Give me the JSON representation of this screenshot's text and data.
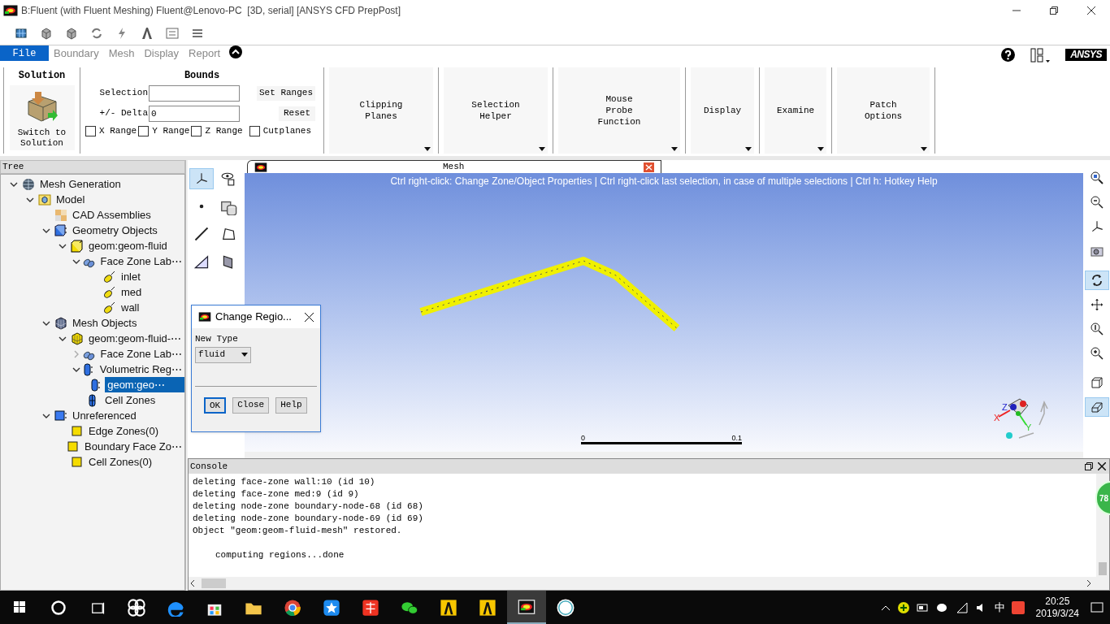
{
  "window": {
    "title": "B:Fluent (with Fluent Meshing) Fluent@Lenovo-PC  [3D, serial] [ANSYS CFD PrepPost]"
  },
  "toolbar": [
    {
      "kind": "mesh"
    },
    {
      "kind": "cube"
    },
    {
      "kind": "cube"
    },
    {
      "kind": "arrows"
    },
    {
      "kind": "bolt"
    },
    {
      "kind": "arch"
    },
    {
      "kind": "swap"
    },
    {
      "kind": "list"
    }
  ],
  "menu_tabs": [
    {
      "label": "File",
      "selected": true
    },
    {
      "label": "Boundary",
      "selected": false
    },
    {
      "label": "Mesh",
      "selected": false
    },
    {
      "label": "Display",
      "selected": false
    },
    {
      "label": "Report",
      "selected": false
    }
  ],
  "brand": "ANSYS",
  "ribbon": {
    "solution": {
      "title": "Solution",
      "button": "Switch to\nSolution"
    },
    "bounds": {
      "title": "Bounds",
      "selection_label": "Selection",
      "delta_label": "+/- Delta",
      "delta_value": "0",
      "set_ranges": "Set Ranges",
      "reset": "Reset",
      "checks": [
        {
          "label": "X Range",
          "checked": false
        },
        {
          "label": "Y Range",
          "checked": false
        },
        {
          "label": "Z Range",
          "checked": false
        },
        {
          "label": "Cutplanes",
          "checked": false
        }
      ]
    },
    "groups": [
      {
        "label": "Clipping\nPlanes"
      },
      {
        "label": "Selection\nHelper"
      },
      {
        "label": "Mouse\nProbe\nFunction"
      },
      {
        "label": "Display"
      },
      {
        "label": "Examine"
      },
      {
        "label": "Patch\nOptions"
      }
    ]
  },
  "tree": {
    "title": "Tree",
    "items": [
      {
        "label": "Mesh Generation",
        "kind": "globe",
        "expanded": true,
        "selected": false,
        "children": [
          {
            "label": "Model",
            "kind": "model",
            "expanded": true,
            "selected": false,
            "children": [
              {
                "label": "CAD Assemblies",
                "kind": "cad",
                "selected": false
              },
              {
                "label": "Geometry Objects",
                "kind": "bluecube",
                "expanded": true,
                "selected": false,
                "children": [
                  {
                    "label": "geom:geom-fluid",
                    "kind": "yellowcube",
                    "expanded": true,
                    "selected": false,
                    "children": [
                      {
                        "label": "Face Zone Lab⋯",
                        "kind": "tags",
                        "expanded": true,
                        "selected": false,
                        "children": [
                          {
                            "label": "inlet",
                            "kind": "tag",
                            "selected": false
                          },
                          {
                            "label": "med",
                            "kind": "tag",
                            "selected": false
                          },
                          {
                            "label": "wall",
                            "kind": "tag",
                            "selected": false
                          }
                        ]
                      }
                    ]
                  }
                ]
              },
              {
                "label": "Mesh Objects",
                "kind": "meshcube",
                "expanded": true,
                "selected": false,
                "children": [
                  {
                    "label": "geom:geom-fluid-⋯",
                    "kind": "yellowmesh",
                    "expanded": true,
                    "selected": false,
                    "children": [
                      {
                        "label": "Face Zone Lab⋯",
                        "kind": "tags",
                        "expanded": false,
                        "selected": false
                      },
                      {
                        "label": "Volumetric Reg⋯",
                        "kind": "cylinder",
                        "expanded": true,
                        "selected": false,
                        "children": [
                          {
                            "label": "geom:geo⋯",
                            "kind": "cylinder",
                            "selected": true
                          }
                        ]
                      },
                      {
                        "label": "Cell Zones",
                        "kind": "cells",
                        "selected": false
                      }
                    ]
                  }
                ]
              },
              {
                "label": "Unreferenced",
                "kind": "bluesquare",
                "expanded": true,
                "selected": false,
                "children": [
                  {
                    "label": "Edge Zones(0)",
                    "kind": "yellowsquare",
                    "selected": false
                  },
                  {
                    "label": "Boundary Face Zo⋯",
                    "kind": "yellowsquare",
                    "selected": false
                  },
                  {
                    "label": "Cell Zones(0)",
                    "kind": "yellowsquare",
                    "selected": false
                  }
                ]
              }
            ]
          }
        ]
      }
    ]
  },
  "left_tools": [
    {
      "kind": "axes",
      "selected": true
    },
    {
      "kind": "eye",
      "selected": false
    },
    {
      "kind": "point",
      "selected": false
    },
    {
      "kind": "solids",
      "selected": false
    },
    {
      "kind": "line",
      "selected": false
    },
    {
      "kind": "polygon",
      "selected": false
    },
    {
      "kind": "triangle",
      "selected": false
    },
    {
      "kind": "plane",
      "selected": false
    }
  ],
  "graphics": {
    "tab": "Mesh",
    "hint": "Ctrl right-click: Change Zone/Object Properties | Ctrl right-click last selection, in case of multiple selections | Ctrl h: Hotkey Help",
    "scale_min": "0",
    "scale_max": "0.1",
    "triad_labels": [
      "X",
      "Y",
      "Z"
    ]
  },
  "right_tools": [
    {
      "kind": "zoomfit",
      "selected": false
    },
    {
      "kind": "zoomout",
      "selected": false
    },
    {
      "kind": "axes",
      "selected": false
    },
    {
      "kind": "camera",
      "selected": false
    },
    {
      "kind": "rotate",
      "selected": true
    },
    {
      "kind": "pan",
      "selected": false
    },
    {
      "kind": "zoomscroll",
      "selected": false
    },
    {
      "kind": "zoomin",
      "selected": false
    },
    {
      "kind": "box",
      "selected": false
    },
    {
      "kind": "boxflat",
      "selected": true
    }
  ],
  "dialog": {
    "title": "Change Regio...",
    "field_label": "New Type",
    "value": "fluid",
    "buttons": [
      {
        "label": "OK",
        "default": true
      },
      {
        "label": "Close",
        "default": false
      },
      {
        "label": "Help",
        "default": false
      }
    ]
  },
  "console": {
    "title": "Console",
    "lines": [
      {
        "kind": "log",
        "text": "deleting face-zone wall:10 (id 10)"
      },
      {
        "kind": "log",
        "text": "deleting face-zone med:9 (id 9)"
      },
      {
        "kind": "log",
        "text": "deleting node-zone boundary-node-68 (id 68)"
      },
      {
        "kind": "log",
        "text": "deleting node-zone boundary-node-69 (id 69)"
      },
      {
        "kind": "log",
        "text": "Object \"geom:geom-fluid-mesh\" restored."
      },
      {
        "kind": "result",
        "text": "computing regions...done"
      }
    ],
    "badge": "78"
  },
  "taskbar": {
    "apps": [
      {
        "kind": "search",
        "selected": false
      },
      {
        "kind": "taskview",
        "selected": false
      },
      {
        "kind": "fan",
        "selected": false
      },
      {
        "kind": "edge",
        "selected": false
      },
      {
        "kind": "store",
        "selected": false
      },
      {
        "kind": "folder",
        "selected": false
      },
      {
        "kind": "chrome",
        "selected": false
      },
      {
        "kind": "star",
        "selected": false
      },
      {
        "kind": "dict",
        "selected": false
      },
      {
        "kind": "chat",
        "selected": false
      },
      {
        "kind": "ansys",
        "selected": false
      },
      {
        "kind": "ansys",
        "selected": false
      },
      {
        "kind": "fluent",
        "selected": true
      },
      {
        "kind": "cae",
        "selected": false
      }
    ],
    "ime": "中",
    "time": "20:25",
    "date": "2019/3/24"
  }
}
